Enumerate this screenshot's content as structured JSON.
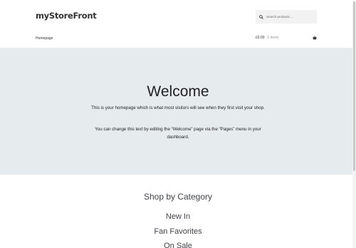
{
  "header": {
    "site_title": "myStoreFront",
    "search_placeholder": "Search products…",
    "nav_home": "Homepage",
    "cart_total": "£0.00",
    "cart_count": "0 items"
  },
  "hero": {
    "title": "Welcome",
    "paragraph_1": "This is your homepage which is what most visitors will see when they first visit your shop.",
    "paragraph_2": "You can change this text by editing the “Welcome” page via the “Pages” menu in your dashboard."
  },
  "categories": {
    "title": "Shop by Category",
    "items": [
      "New In",
      "Fan Favorites",
      "On Sale"
    ]
  },
  "colors": {
    "hero_background": "#e6ecee",
    "text": "#43454b"
  },
  "icons": [
    "search-icon",
    "basket-icon"
  ]
}
